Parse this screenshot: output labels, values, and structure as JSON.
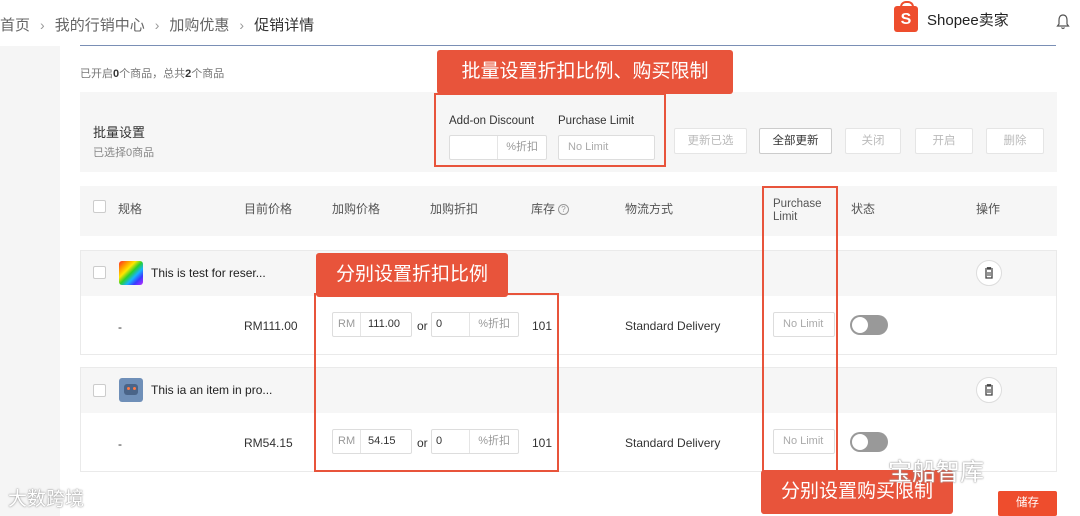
{
  "breadcrumb": [
    "首页",
    "我的行销中心",
    "加购优惠",
    "促销详情"
  ],
  "brand": {
    "name": "Shopee卖家",
    "icon": "shopee-bag-icon",
    "color": "#ee4d2d"
  },
  "summary": {
    "prefix": "已开启",
    "enabled": "0",
    "middle": "个商品，总共",
    "total": "2",
    "suffix": "个商品"
  },
  "batch": {
    "title": "批量设置",
    "selected": "已选择0商品",
    "discount_label": "Add-on Discount",
    "discount_suffix": "%折扣",
    "limit_label": "Purchase Limit",
    "limit_placeholder": "No Limit",
    "buttons": [
      "更新已选",
      "全部更新",
      "关闭",
      "开启",
      "删除"
    ]
  },
  "table": {
    "headers": {
      "spec": "规格",
      "current_price": "目前价格",
      "addon_price": "加购价格",
      "addon_discount": "加购折扣",
      "stock": "库存",
      "shipping": "物流方式",
      "purchase_limit": "Purchase Limit",
      "status": "状态",
      "actions": "操作"
    }
  },
  "items": [
    {
      "name": "This is test for reser...",
      "spec": "-",
      "current_price": "RM111.00",
      "currency": "RM",
      "addon_price": "111.00",
      "or": "or",
      "discount": "0",
      "discount_suffix": "%折扣",
      "stock": "101",
      "shipping": "Standard Delivery",
      "limit_placeholder": "No Limit",
      "enabled": false
    },
    {
      "name": "This ia an item in pro...",
      "spec": "-",
      "current_price": "RM54.15",
      "currency": "RM",
      "addon_price": "54.15",
      "or": "or",
      "discount": "0",
      "discount_suffix": "%折扣",
      "stock": "101",
      "shipping": "Standard Delivery",
      "limit_placeholder": "No Limit",
      "enabled": false
    }
  ],
  "annotations": {
    "batch_note": "批量设置折扣比例、购买限制",
    "item_discount_note": "分别设置折扣比例",
    "item_limit_note": "分别设置购买限制"
  },
  "save_label": "储存",
  "watermarks": {
    "left": "大数跨境",
    "right": "宝船智库"
  }
}
